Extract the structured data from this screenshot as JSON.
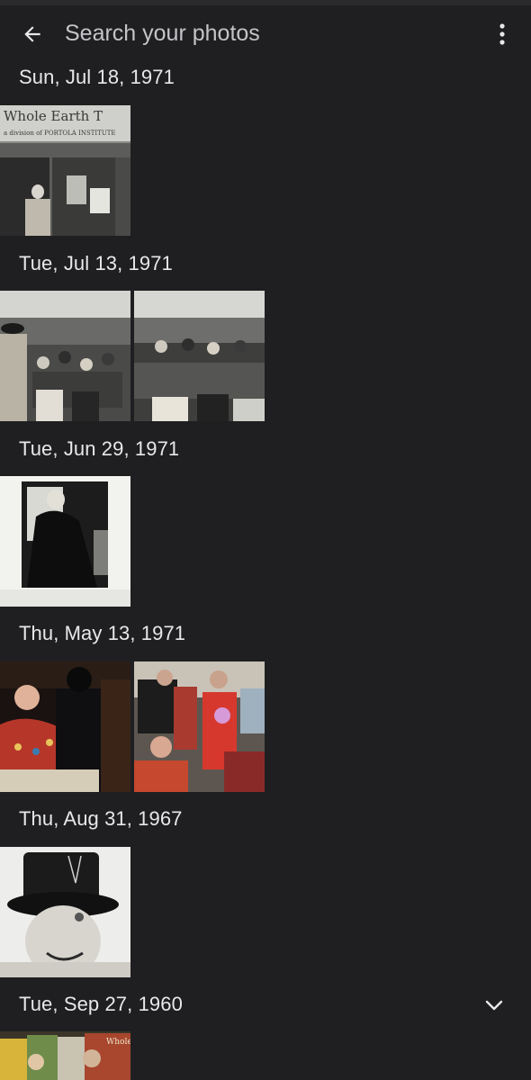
{
  "search": {
    "placeholder": "Search your photos"
  },
  "icons": {
    "back": "arrow-left-icon",
    "more": "more-vert-icon",
    "expand": "chevron-down-icon"
  },
  "groups": [
    {
      "date": "Sun, Jul 18, 1971"
    },
    {
      "date": "Tue, Jul 13, 1971"
    },
    {
      "date": "Tue, Jun 29, 1971"
    },
    {
      "date": "Thu, May 13, 1971"
    },
    {
      "date": "Thu, Aug 31, 1967"
    },
    {
      "date": "Tue, Sep 27, 1960"
    }
  ],
  "photo_text": {
    "storefront_sign": "Whole Earth T",
    "storefront_subsign": "a division of PORTOLA INSTITUTE",
    "book_cover_text": "Whole Ea"
  },
  "colors": {
    "background": "#1f1f21",
    "text": "#e8e8ea",
    "muted": "#c4c4c8"
  }
}
